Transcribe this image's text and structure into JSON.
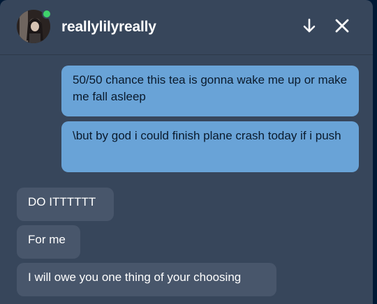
{
  "conversation": {
    "username": "reallylilyreally",
    "online_color": "#3fd36b"
  },
  "header": {
    "minimize_icon": "arrow-down-icon",
    "close_icon": "close-icon"
  },
  "messages": [
    {
      "sender": "me",
      "text": "50/50 chance this tea is gonna wake me up or make me fall asleep"
    },
    {
      "sender": "me",
      "text": "\\but by god i could finish plane crash today if i push"
    },
    {
      "sender": "them",
      "text": "DO ITTTTTT"
    },
    {
      "sender": "them",
      "text": "For me"
    },
    {
      "sender": "them",
      "text": "I will owe you one thing of your choosing"
    }
  ],
  "colors": {
    "background": "#37465b",
    "my_bubble": "#69a3d7",
    "their_bubble": "#48566b"
  }
}
